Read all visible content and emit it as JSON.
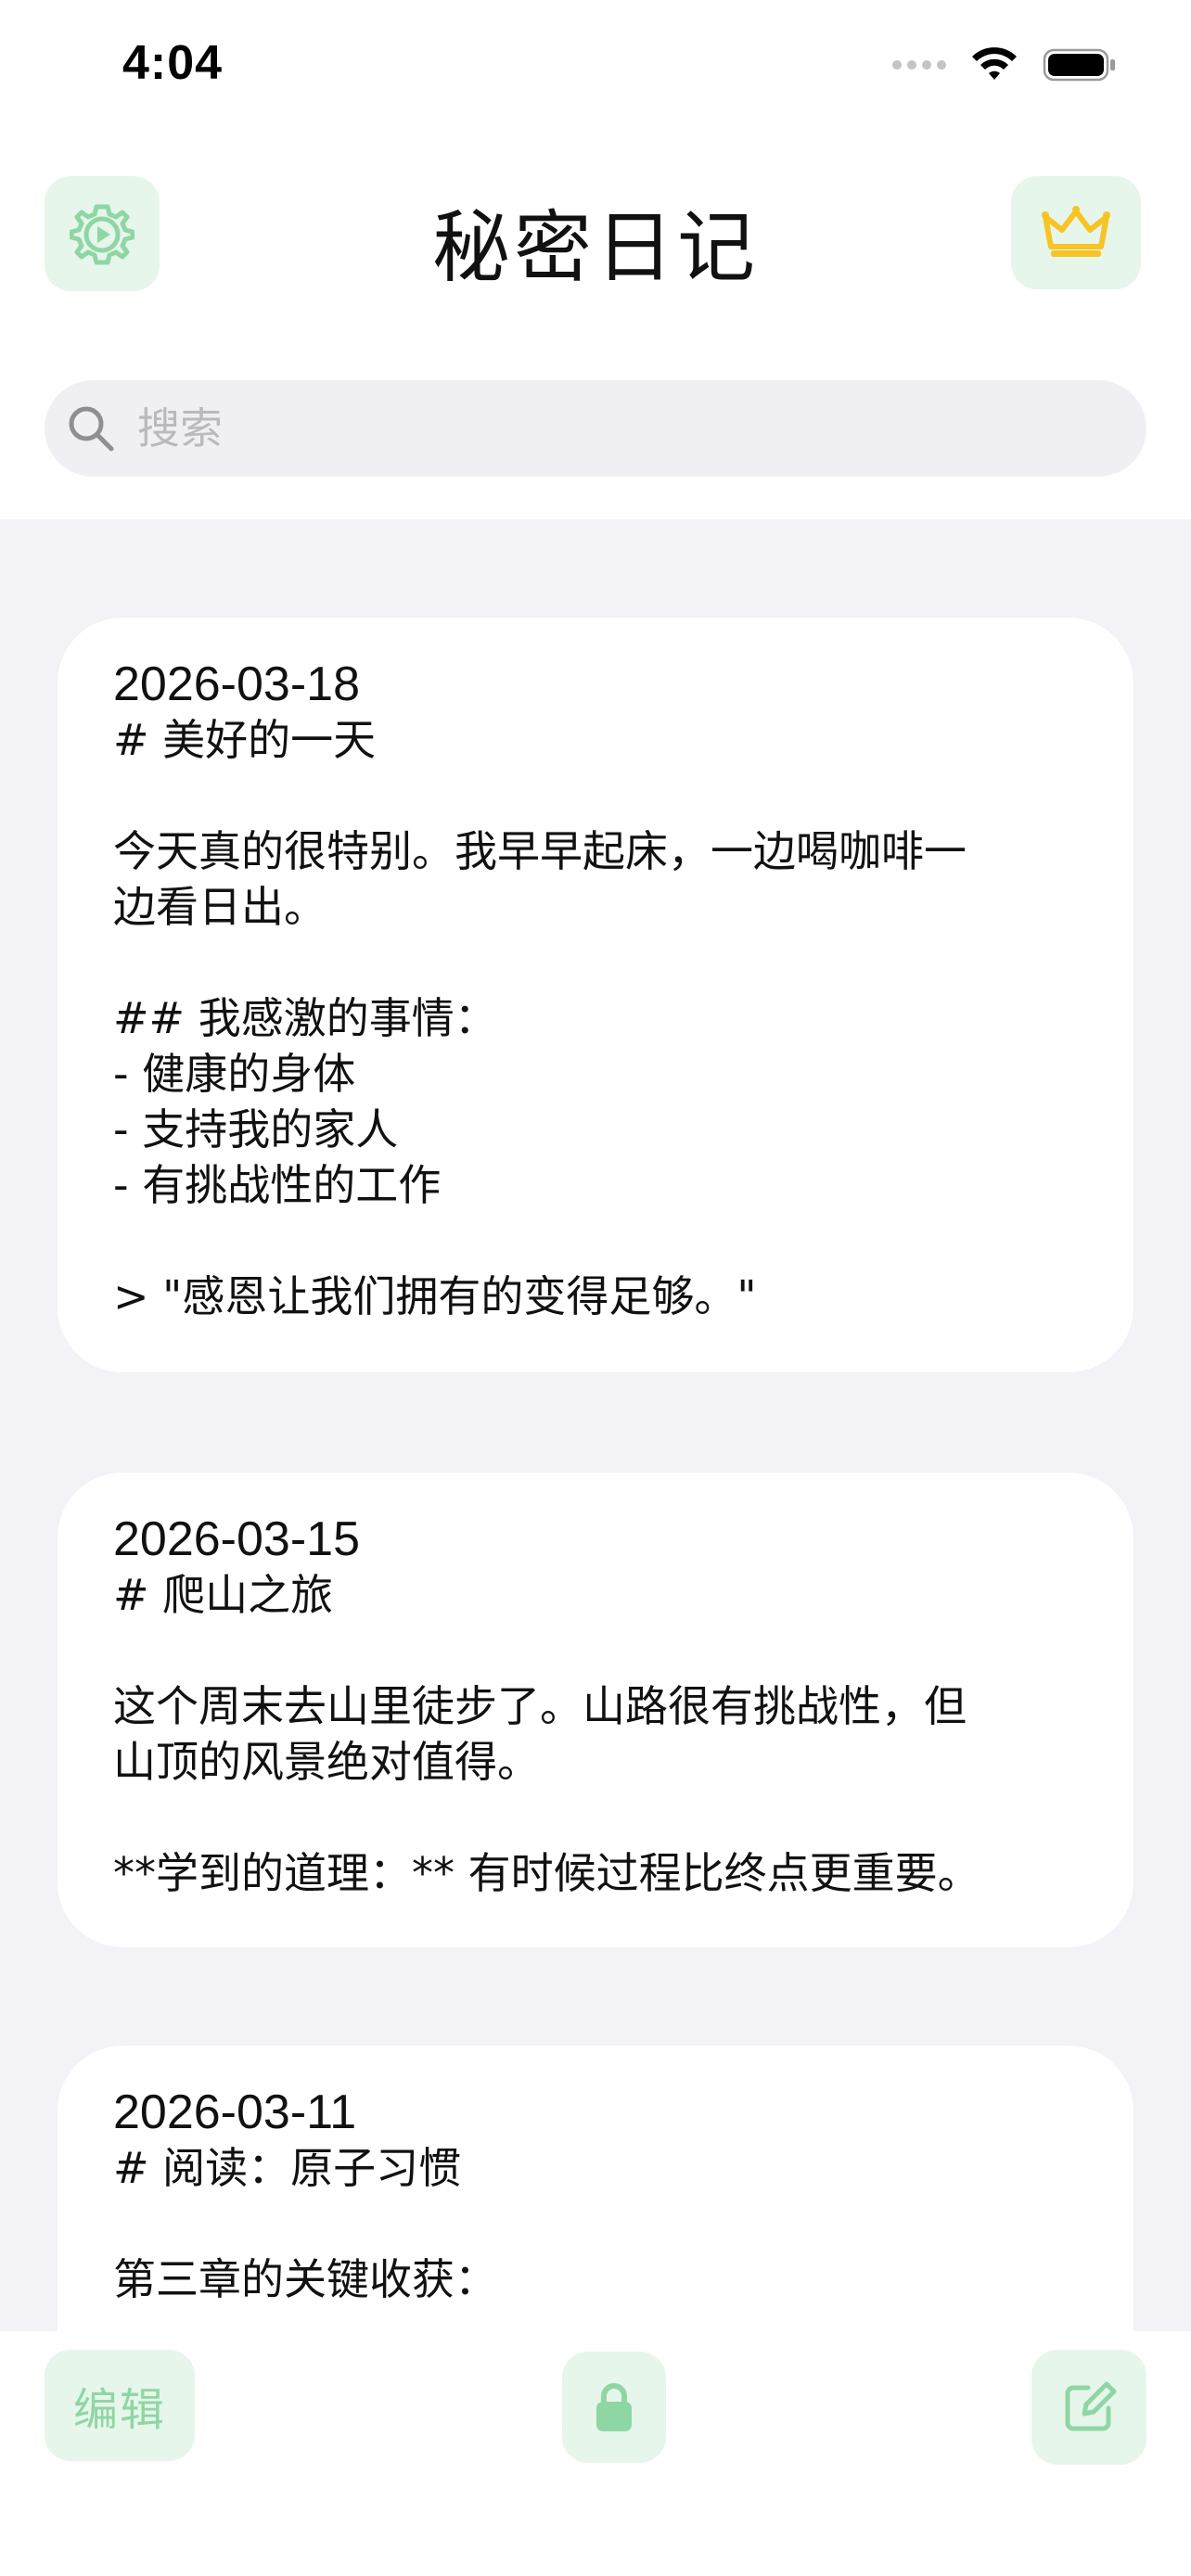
{
  "status_bar": {
    "time": "4:04"
  },
  "header": {
    "title": "秘密日记",
    "settings_icon": "gear-play-icon",
    "premium_icon": "crown-icon"
  },
  "search": {
    "placeholder": "搜索",
    "value": ""
  },
  "entries": [
    {
      "date": "2026-03-18",
      "lines": [
        "# 美好的一天",
        "",
        "今天真的很特别。我早早起床，一边喝咖啡一",
        "边看日出。",
        "",
        "## 我感激的事情：",
        "- 健康的身体",
        "- 支持我的家人",
        "- 有挑战性的工作",
        "",
        "> \"感恩让我们拥有的变得足够。\""
      ]
    },
    {
      "date": "2026-03-15",
      "lines": [
        "# 爬山之旅",
        "",
        "这个周末去山里徒步了。山路很有挑战性，但",
        "山顶的风景绝对值得。",
        "",
        "**学到的道理：** 有时候过程比终点更重要。"
      ]
    },
    {
      "date": "2026-03-11",
      "lines": [
        "# 阅读：原子习惯",
        "",
        "第三章的关键收获："
      ]
    }
  ],
  "toolbar": {
    "edit_label": "编辑",
    "lock_icon": "lock-icon",
    "compose_icon": "compose-icon"
  },
  "colors": {
    "accent_green": "#8fd6a5",
    "tile_background": "#e6f6ea",
    "crown_gold": "#f7c325",
    "page_background": "#f2f2f7"
  }
}
